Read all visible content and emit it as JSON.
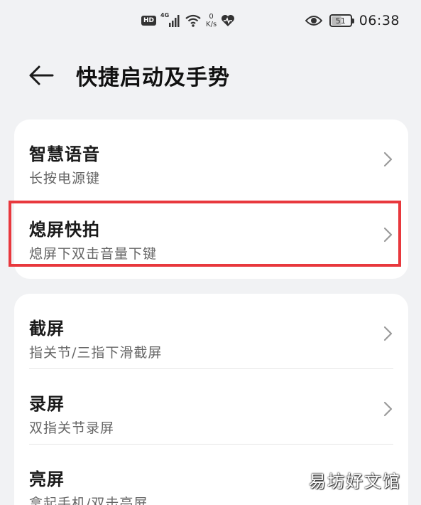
{
  "status_bar": {
    "hd": "HD",
    "network": "4G",
    "speed_value": "0",
    "speed_unit": "K/s",
    "battery": "51",
    "battery_level": 0.51,
    "time": "06:38",
    "icons": [
      "hd-icon",
      "signal-icon",
      "wifi-icon",
      "heart-icon",
      "eye-icon",
      "battery-icon"
    ]
  },
  "header": {
    "title": "快捷启动及手势",
    "back_icon": "arrow-left-icon"
  },
  "groups": [
    {
      "items": [
        {
          "title": "智慧语音",
          "subtitle": "长按电源键"
        },
        {
          "title": "熄屏快拍",
          "subtitle": "熄屏下双击音量下键"
        }
      ]
    },
    {
      "items": [
        {
          "title": "截屏",
          "subtitle": "指关节/三指下滑截屏"
        },
        {
          "title": "录屏",
          "subtitle": "双指关节录屏"
        },
        {
          "title": "亮屏",
          "subtitle": "拿起手机/双击亮屏"
        }
      ]
    }
  ],
  "annotation": {
    "color": "#e8383d"
  },
  "watermark": {
    "text": "易坊好文馆"
  }
}
